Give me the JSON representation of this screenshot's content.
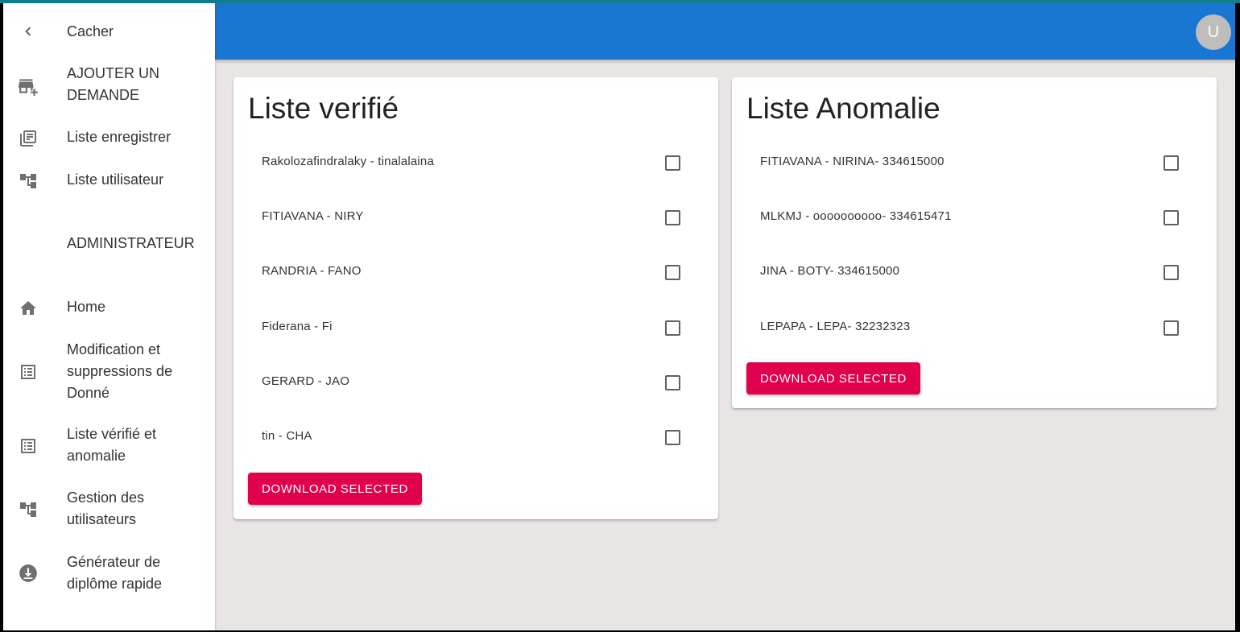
{
  "sidebar": {
    "items": [
      {
        "label": "Cacher",
        "icon": "chevron-left-icon"
      },
      {
        "label": "AJOUTER UN DEMANDE",
        "icon": "add-business-icon"
      },
      {
        "label": "Liste enregistrer",
        "icon": "library-books-icon"
      },
      {
        "label": "Liste utilisateur",
        "icon": "account-tree-icon"
      },
      {
        "label": "ADMINISTRATEUR"
      },
      {
        "label": "Home",
        "icon": "home-icon"
      },
      {
        "label": "Modification et suppressions de Donné",
        "icon": "list-alt-icon"
      },
      {
        "label": "Liste vérifié et anomalie",
        "icon": "list-alt-icon"
      },
      {
        "label": "Gestion des utilisateurs",
        "icon": "account-tree-icon"
      },
      {
        "label": "Générateur de diplôme rapide",
        "icon": "download-circle-icon"
      }
    ]
  },
  "appbar": {
    "avatar_letter": "U",
    "color": "#1976d2"
  },
  "verified": {
    "title": "Liste verifié",
    "items": [
      "Rakolozafindralaky - tinalalaina",
      "FITIAVANA - NIRY",
      "RANDRIA - FANO",
      "Fiderana - Fi",
      "GERARD - JAO",
      "tin - CHA"
    ],
    "button": "DOWNLOAD SELECTED"
  },
  "anomalie": {
    "title": "Liste Anomalie",
    "items": [
      "FITIAVANA - NIRINA- 334615000",
      "MLKMJ - oooooooooo- 334615471",
      "JINA - BOTY- 334615000",
      "LEPAPA - LEPA- 32232323"
    ],
    "button": "DOWNLOAD SELECTED"
  },
  "accent_color": "#e0004d"
}
